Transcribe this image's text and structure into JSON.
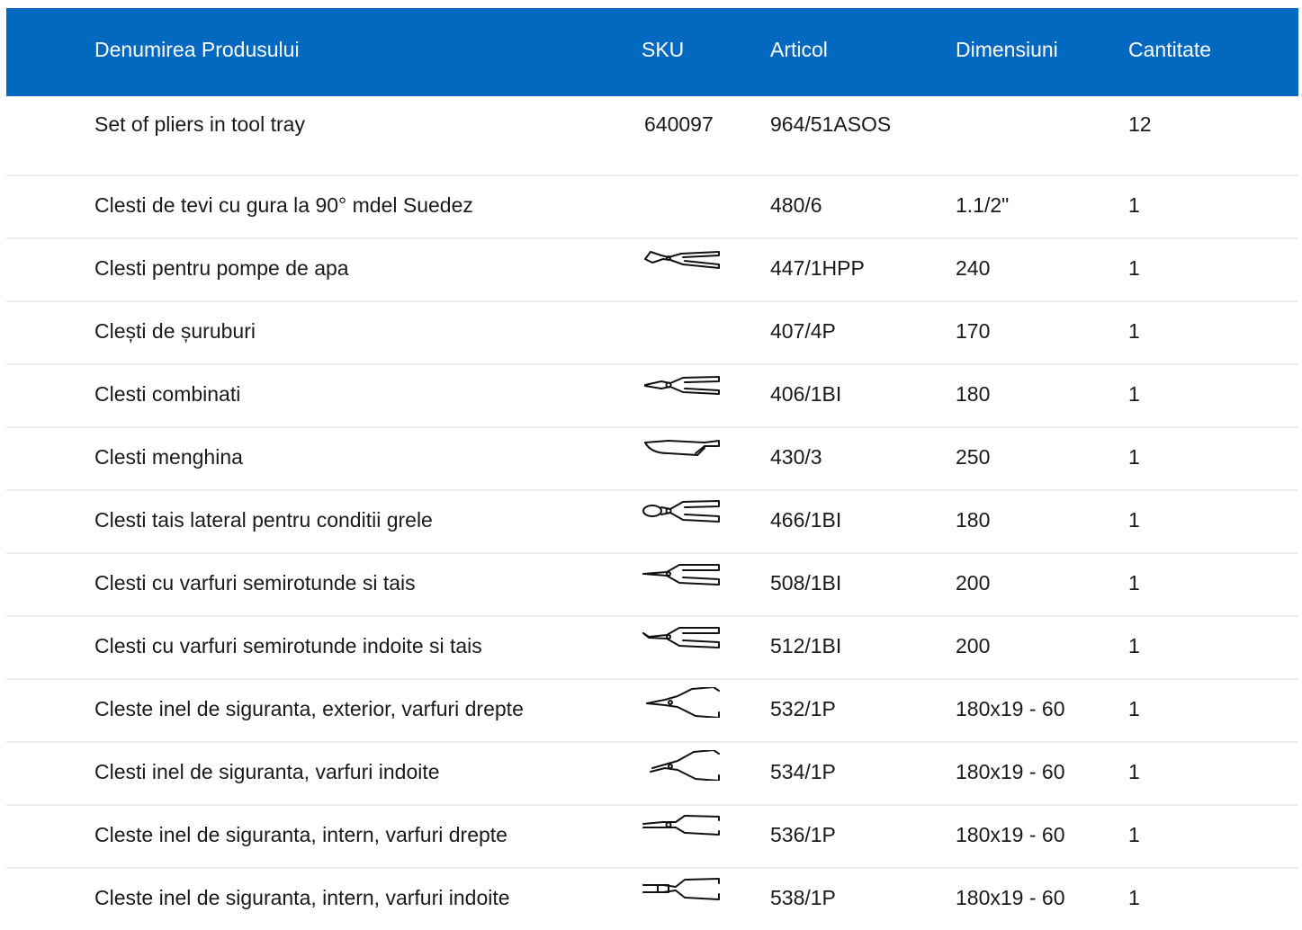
{
  "colors": {
    "header_bg": "#0368c0",
    "header_text": "#ffffff",
    "row_divider": "#ececec"
  },
  "columns": {
    "name": "Denumirea Produsului",
    "sku": "SKU",
    "articol": "Articol",
    "dimensiuni": "Dimensiuni",
    "cantitate": "Cantitate"
  },
  "rows": [
    {
      "name": "Set of pliers in tool tray",
      "sku": "640097",
      "articol": "964/51ASOS",
      "dimensiuni": "",
      "cantitate": "12",
      "icon": ""
    },
    {
      "name": "Clesti de tevi cu gura la 90° mdel Suedez",
      "sku": "",
      "articol": "480/6",
      "dimensiuni": "1.1/2\"",
      "cantitate": "1",
      "icon": ""
    },
    {
      "name": "Clesti pentru pompe de apa",
      "sku": "",
      "articol": "447/1HPP",
      "dimensiuni": "240",
      "cantitate": "1",
      "icon": "water-pump-pliers-icon"
    },
    {
      "name": "Clești de șuruburi",
      "sku": "",
      "articol": "407/4P",
      "dimensiuni": "170",
      "cantitate": "1",
      "icon": ""
    },
    {
      "name": "Clesti combinati",
      "sku": "",
      "articol": "406/1BI",
      "dimensiuni": "180",
      "cantitate": "1",
      "icon": "combination-pliers-icon"
    },
    {
      "name": "Clesti menghina",
      "sku": "",
      "articol": "430/3",
      "dimensiuni": "250",
      "cantitate": "1",
      "icon": "locking-pliers-icon"
    },
    {
      "name": "Clesti tais lateral pentru conditii grele",
      "sku": "",
      "articol": "466/1BI",
      "dimensiuni": "180",
      "cantitate": "1",
      "icon": "side-cutter-icon"
    },
    {
      "name": "Clesti cu varfuri semirotunde si tais",
      "sku": "",
      "articol": "508/1BI",
      "dimensiuni": "200",
      "cantitate": "1",
      "icon": "long-nose-pliers-icon"
    },
    {
      "name": "Clesti cu varfuri semirotunde indoite si tais",
      "sku": "",
      "articol": "512/1BI",
      "dimensiuni": "200",
      "cantitate": "1",
      "icon": "bent-nose-pliers-icon"
    },
    {
      "name": "Cleste inel de siguranta, exterior, varfuri drepte",
      "sku": "",
      "articol": "532/1P",
      "dimensiuni": "180x19 - 60",
      "cantitate": "1",
      "icon": "circlip-pliers-icon"
    },
    {
      "name": "Clesti inel de siguranta, varfuri indoite",
      "sku": "",
      "articol": "534/1P",
      "dimensiuni": "180x19 - 60",
      "cantitate": "1",
      "icon": "circlip-pliers-bent-icon"
    },
    {
      "name": "Cleste inel de siguranta, intern, varfuri drepte",
      "sku": "",
      "articol": "536/1P",
      "dimensiuni": "180x19 - 60",
      "cantitate": "1",
      "icon": "internal-circlip-pliers-icon"
    },
    {
      "name": "Cleste inel de siguranta, intern, varfuri indoite",
      "sku": "",
      "articol": "538/1P",
      "dimensiuni": "180x19 - 60",
      "cantitate": "1",
      "icon": "internal-circlip-pliers-bent-icon"
    }
  ]
}
